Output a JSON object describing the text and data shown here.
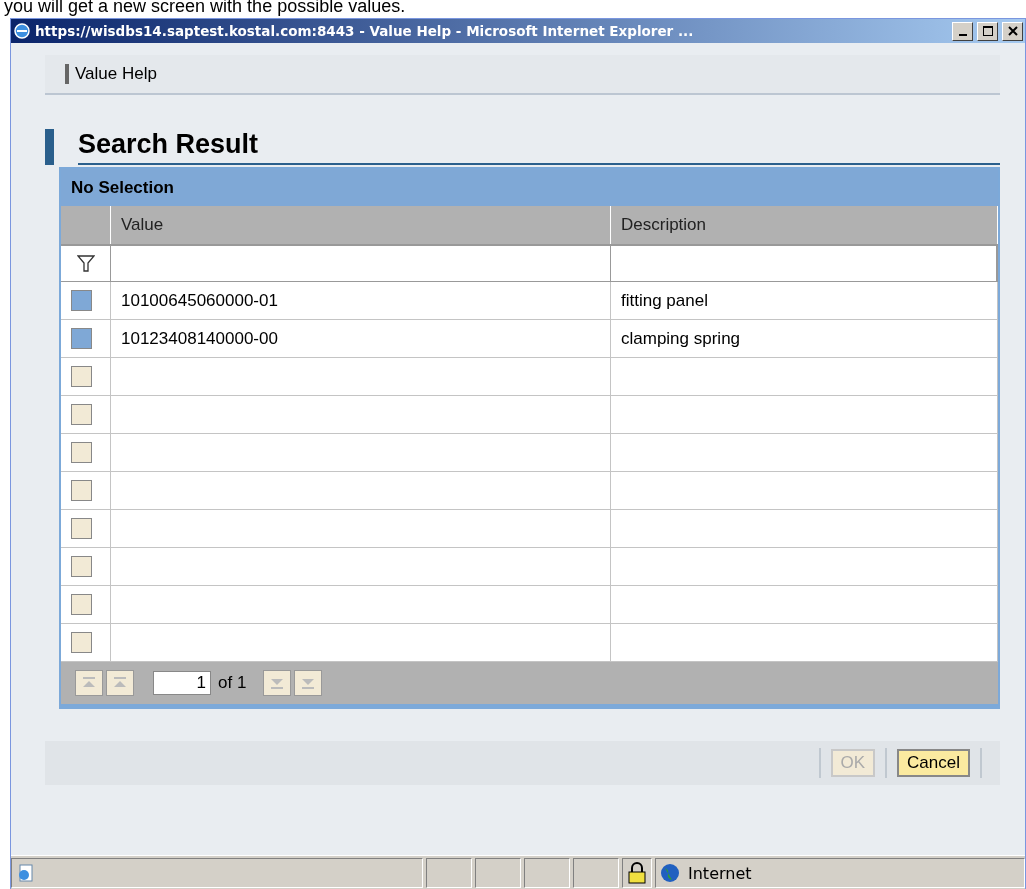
{
  "caption": "you will get a new screen with the possible values.",
  "window": {
    "title": "https://wisdbs14.saptest.kostal.com:8443 - Value Help - Microsoft Internet Explorer ..."
  },
  "toolbar": {
    "title": "Value Help"
  },
  "section": {
    "title": "Search Result"
  },
  "table": {
    "selection_label": "No Selection",
    "columns": [
      "Value",
      "Description"
    ],
    "rows": [
      {
        "kind": "item",
        "value": "10100645060000-01",
        "description": "fitting panel"
      },
      {
        "kind": "item",
        "value": "10123408140000-00",
        "description": "clamping spring"
      },
      {
        "kind": "empty"
      },
      {
        "kind": "empty"
      },
      {
        "kind": "empty"
      },
      {
        "kind": "empty"
      },
      {
        "kind": "empty"
      },
      {
        "kind": "empty"
      },
      {
        "kind": "empty"
      },
      {
        "kind": "empty"
      }
    ],
    "pager": {
      "page": "1",
      "of": "of 1"
    }
  },
  "buttons": [
    {
      "label": "OK",
      "disabled": true
    },
    {
      "label": "Cancel",
      "disabled": false
    }
  ],
  "status_bar": {
    "zone": "Internet"
  }
}
